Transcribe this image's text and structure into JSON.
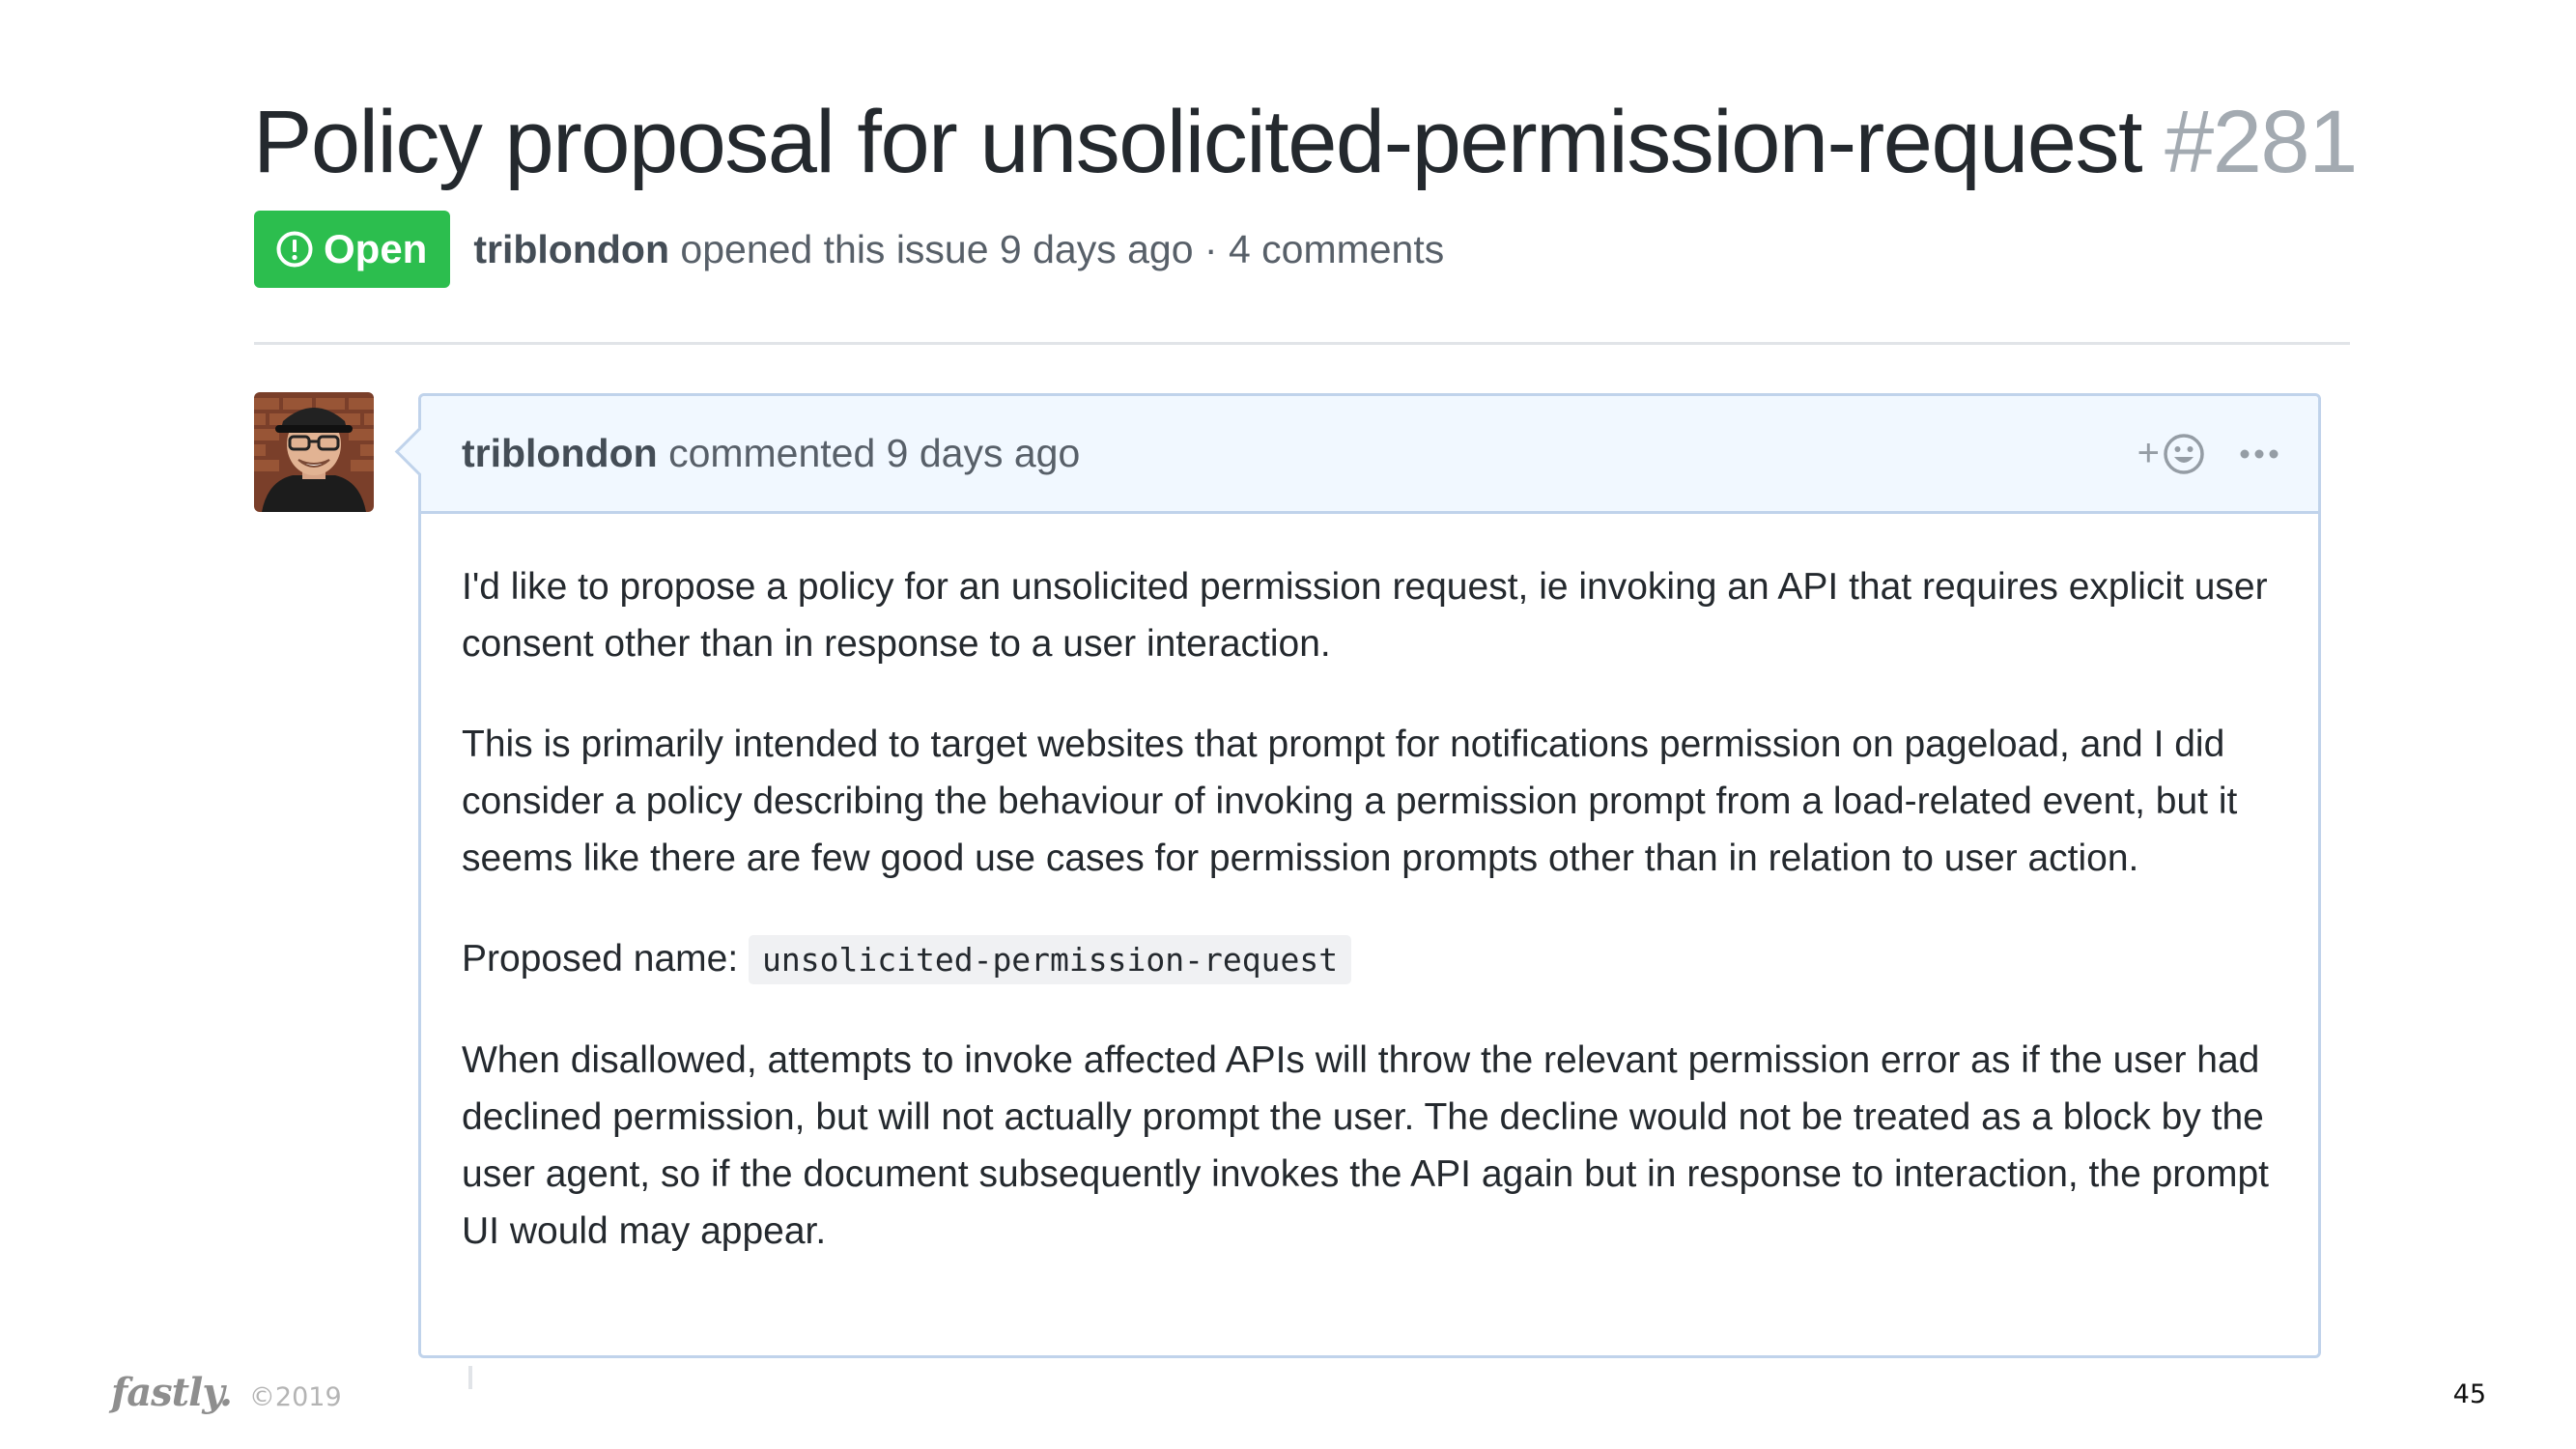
{
  "issue": {
    "title": "Policy proposal for unsolicited-permission-request",
    "number": "#281",
    "state": "Open",
    "state_color": "#2cbe4e",
    "state_icon": "issue-opened-icon",
    "author": "triblondon",
    "meta_text": "opened this issue 9 days ago · 4 comments"
  },
  "comment": {
    "author": "triblondon",
    "action_text": "commented 9 days ago",
    "reaction_button": "+",
    "reaction_icon": "smiley-icon",
    "more_icon": "kebab-horizontal-icon",
    "paragraphs": [
      "I'd like to propose a policy for an unsolicited permission request, ie invoking an API that requires explicit user consent other than in response to a user interaction.",
      "This is primarily intended to target websites that prompt for notifications permission on pageload, and I did consider a policy describing the behaviour of invoking a permission prompt from a load-related event, but it seems like there are few good use cases for permission prompts other than in relation to user action."
    ],
    "proposed_name_label": "Proposed name:",
    "proposed_name_code": "unsolicited-permission-request",
    "closing_paragraph": "When disallowed, attempts to invoke affected APIs will throw the relevant permission error as if the user had declined permission, but will not actually prompt the user. The decline would not be treated as a block by the user agent, so if the document subsequently invokes the API again but in response to interaction, the prompt UI would may appear."
  },
  "footer": {
    "logo": "fastly.",
    "copyright": "©2019",
    "page_number": "45"
  },
  "colors": {
    "header_bg": "#f1f8ff",
    "comment_border": "#c0d3eb",
    "number_gray": "#a3aab1"
  }
}
